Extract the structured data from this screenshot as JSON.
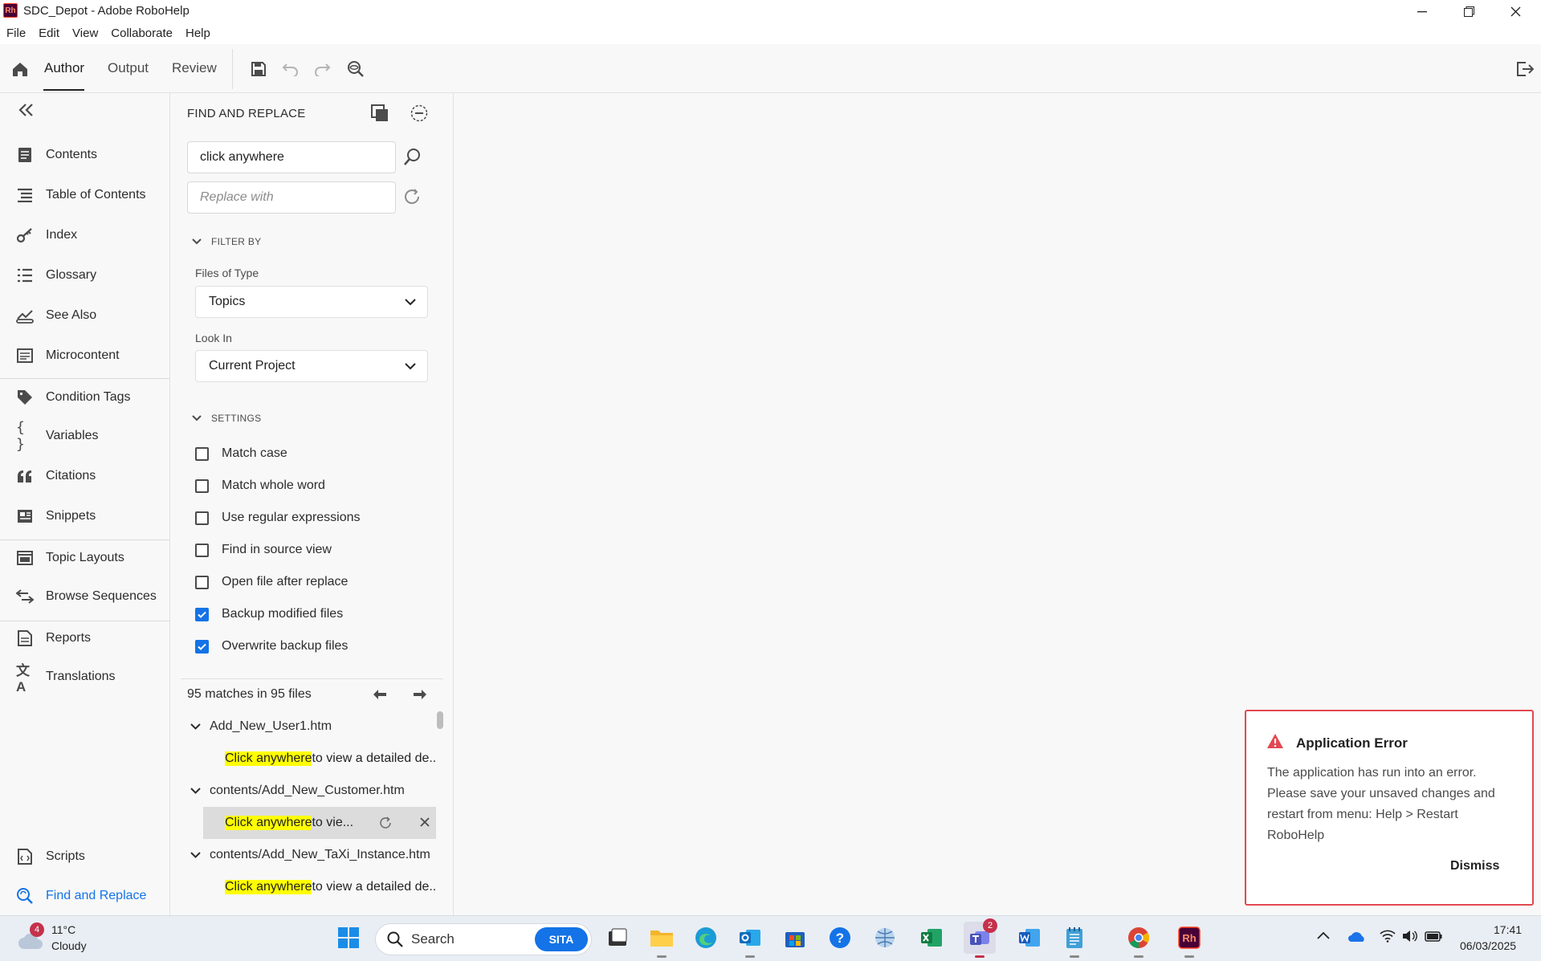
{
  "window": {
    "title": "SDC_Depot - Adobe RoboHelp",
    "app_icon_text": "Rh"
  },
  "menu": [
    "File",
    "Edit",
    "View",
    "Collaborate",
    "Help"
  ],
  "toolbar": {
    "tabs": [
      "Author",
      "Output",
      "Review"
    ],
    "active_tab": "Author"
  },
  "nav": {
    "items": [
      {
        "label": "Contents",
        "icon": "contents-icon"
      },
      {
        "label": "Table of Contents",
        "icon": "toc-icon"
      },
      {
        "label": "Index",
        "icon": "key-icon"
      },
      {
        "label": "Glossary",
        "icon": "glossary-icon"
      },
      {
        "label": "See Also",
        "icon": "see-also-icon"
      },
      {
        "label": "Microcontent",
        "icon": "microcontent-icon"
      },
      {
        "label": "Condition Tags",
        "icon": "tag-icon"
      },
      {
        "label": "Variables",
        "icon": "braces-icon"
      },
      {
        "label": "Citations",
        "icon": "quote-icon"
      },
      {
        "label": "Snippets",
        "icon": "snippet-icon"
      },
      {
        "label": "Topic Layouts",
        "icon": "layout-icon"
      },
      {
        "label": "Browse Sequences",
        "icon": "sequence-icon"
      },
      {
        "label": "Reports",
        "icon": "report-icon"
      },
      {
        "label": "Translations",
        "icon": "translate-icon"
      }
    ],
    "bottom": [
      {
        "label": "Scripts",
        "icon": "script-icon"
      },
      {
        "label": "Find and Replace",
        "icon": "find-replace-icon"
      }
    ]
  },
  "find_replace": {
    "title": "FIND AND REPLACE",
    "find_value": "click anywhere",
    "replace_placeholder": "Replace with",
    "filter_heading": "FILTER BY",
    "files_of_type_label": "Files of Type",
    "files_of_type_value": "Topics",
    "look_in_label": "Look In",
    "look_in_value": "Current Project",
    "settings_heading": "SETTINGS",
    "settings": [
      {
        "label": "Match case",
        "checked": false
      },
      {
        "label": "Match whole word",
        "checked": false
      },
      {
        "label": "Use regular expressions",
        "checked": false
      },
      {
        "label": "Find in source view",
        "checked": false
      },
      {
        "label": "Open file after replace",
        "checked": false
      },
      {
        "label": "Backup modified files",
        "checked": true
      },
      {
        "label": "Overwrite backup files",
        "checked": true
      }
    ],
    "match_count": "95 matches in 95 files",
    "results": [
      {
        "file": "Add_New_User1.htm",
        "hit": "Click anywhere",
        "rest": "to view a detailed de..."
      },
      {
        "file": "contents/Add_New_Customer.htm",
        "hit": "Click anywhere",
        "rest": "to vie..."
      },
      {
        "file": "contents/Add_New_TaXi_Instance.htm",
        "hit": "Click anywhere",
        "rest": "to view a detailed de..."
      }
    ]
  },
  "toast": {
    "title": "Application Error",
    "body": "The application has run into an error. Please save your unsaved changes and restart from menu: Help > Restart RoboHelp",
    "dismiss": "Dismiss"
  },
  "taskbar": {
    "weather_temp": "11°C",
    "weather_desc": "Cloudy",
    "weather_badge": "4",
    "search_label": "Search",
    "search_pill": "SITA",
    "teams_badge": "2",
    "time": "17:41",
    "date": "06/03/2025"
  },
  "colors": {
    "accent": "#1473e6",
    "error": "#e34850",
    "highlight": "#ffff00"
  }
}
